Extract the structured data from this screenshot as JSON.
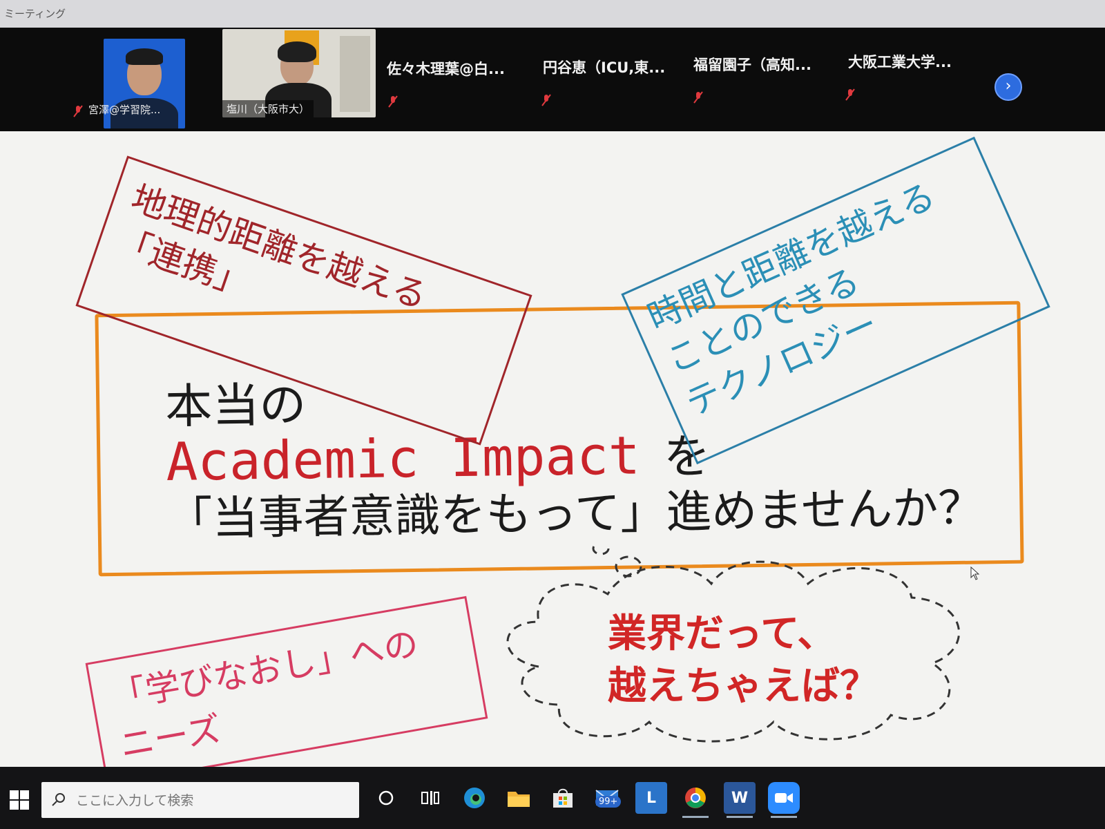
{
  "window": {
    "title": "ミーティング"
  },
  "participants": {
    "video": [
      {
        "name": "宮澤@学習院..."
      },
      {
        "name": "塩川（大阪市大）"
      }
    ],
    "text": [
      {
        "name": "佐々木理葉@白..."
      },
      {
        "name": "円谷恵（ICU,東..."
      },
      {
        "name": "福留園子（高知..."
      },
      {
        "name": "大阪工業大学..."
      }
    ],
    "next_icon": "chevron-right-icon"
  },
  "slide": {
    "geo_box": {
      "line1": "地理的距離を越える",
      "line2": "「連携」"
    },
    "tech_box": {
      "line1": "時間と距離を越える",
      "line2": "ことのできる",
      "line3": "テクノロジー"
    },
    "main": {
      "line1": "本当の",
      "line2_highlight": "Academic Impact",
      "line2_tail": "を",
      "line3": "「当事者意識をもって」進めませんか？"
    },
    "learn_box": {
      "line1": "「学びなおし」への",
      "line2": "ニーズ"
    },
    "cloud": {
      "line1": "業界だって、",
      "line2": "越えちゃえば？"
    },
    "colors": {
      "geo": "#a0252a",
      "tech": "#2b7fa8",
      "main_border": "#ea8a1e",
      "highlight": "#c9232a",
      "learn": "#d63c62",
      "cloud_text": "#d12626"
    }
  },
  "taskbar": {
    "search_placeholder": "ここに入力して検索",
    "mail_badge": "99+",
    "lync_label": "L",
    "word_label": "W"
  }
}
